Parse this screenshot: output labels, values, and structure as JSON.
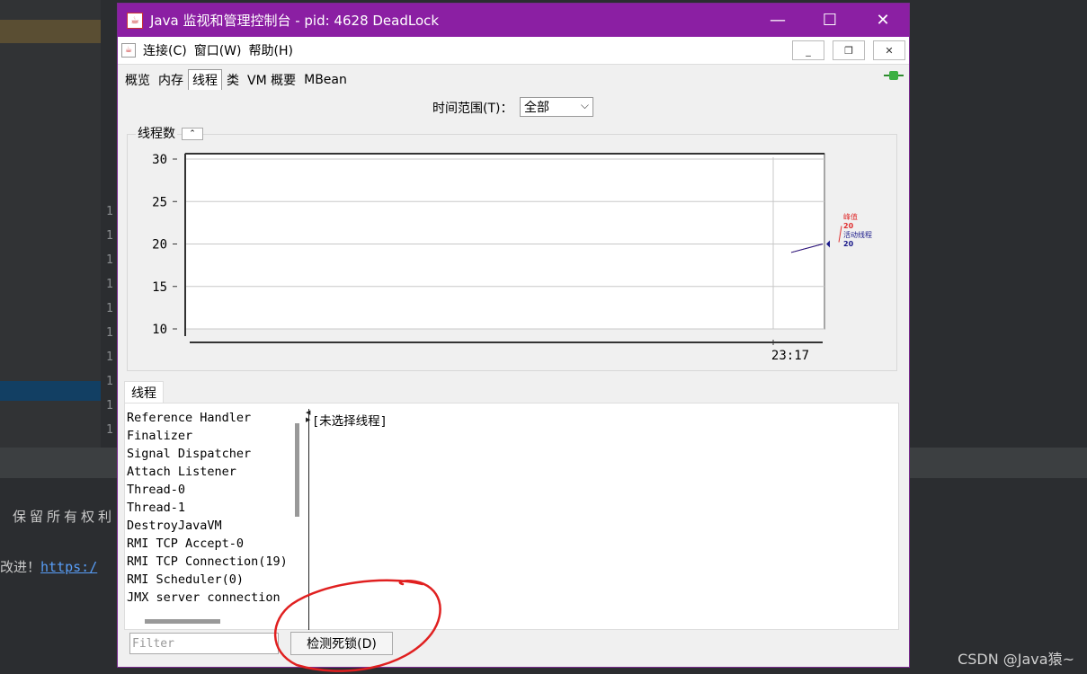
{
  "window": {
    "title": "Java 监视和管理控制台 - pid: 4628 DeadLock",
    "minimize_glyph": "—",
    "maximize_glyph": "☐",
    "close_glyph": "✕"
  },
  "menubar": {
    "items": [
      "连接(C)",
      "窗口(W)",
      "帮助(H)"
    ],
    "mdi_minimize": "_",
    "mdi_restore": "❐",
    "mdi_close": "✕"
  },
  "tabs": [
    "概览",
    "内存",
    "线程",
    "类",
    "VM 概要",
    "MBean"
  ],
  "active_tab": "线程",
  "time_range": {
    "label": "时间范围(T)：",
    "value": "全部",
    "chevron": "⌵"
  },
  "chart_panel": {
    "title": "线程数",
    "collapse_glyph": "⌃"
  },
  "chart_data": {
    "type": "line",
    "ylim": [
      10,
      30
    ],
    "yticks": [
      "30",
      "25",
      "20",
      "15",
      "10"
    ],
    "xticks": [
      "23:17"
    ],
    "series": [
      {
        "name": "峰值",
        "last_value": "20",
        "color": "#e03030",
        "values": [
          19,
          20
        ]
      },
      {
        "name": "活动线程",
        "last_value": "20",
        "color": "#1a1a8a",
        "values": [
          19,
          20
        ]
      }
    ]
  },
  "threads_panel": {
    "tab_label": "线程",
    "threads": [
      "Reference Handler",
      "Finalizer",
      "Signal Dispatcher",
      "Attach Listener",
      "Thread-0",
      "Thread-1",
      "DestroyJavaVM",
      "RMI TCP Accept-0",
      "RMI TCP Connection(19)",
      "RMI Scheduler(0)",
      "JMX server connection"
    ],
    "detail_text": "[未选择线程]",
    "filter_placeholder": "Filter",
    "detect_button": "检测死锁(D)"
  },
  "background": {
    "gutter_numbers": [
      "1",
      "1",
      "1",
      "1",
      "1",
      "1",
      "1",
      "1",
      "1",
      "1"
    ],
    "text_line1": "保留所有权利",
    "text_line2_prefix": "改进！",
    "text_line2_link": "https:/",
    "watermark": "CSDN @Java猿~"
  },
  "colors": {
    "titlebar": "#8b1fa3",
    "annotation_circle": "#e02020"
  }
}
